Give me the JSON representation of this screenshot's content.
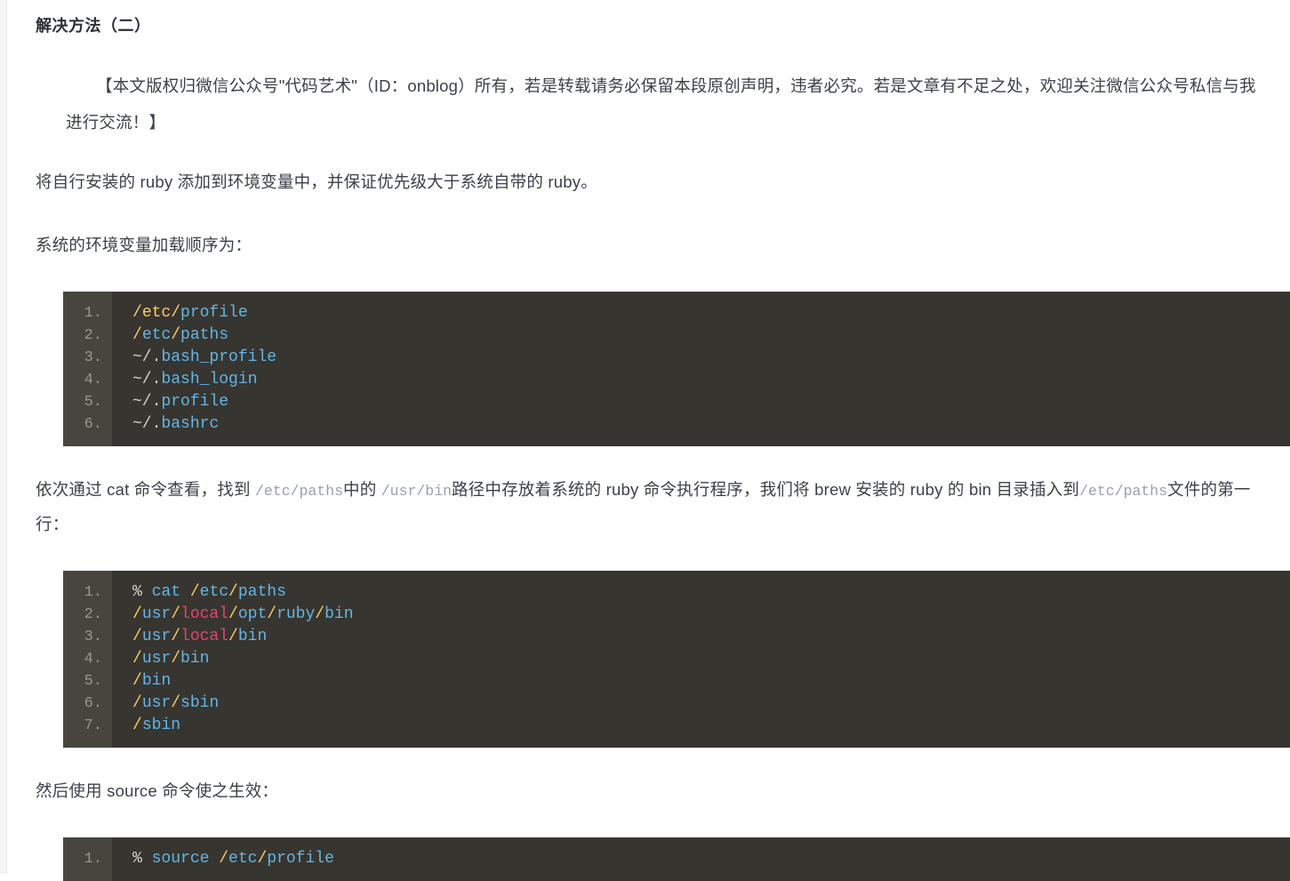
{
  "section": {
    "title": "解决方法（二）"
  },
  "copyright_note": "【本文版权归微信公众号\"代码艺术\"（ID：onblog）所有，若是转载请务必保留本段原创声明，违者必究。若是文章有不足之处，欢迎关注微信公众号私信与我进行交流！】",
  "paragraphs": {
    "p1": "将自行安装的 ruby 添加到环境变量中，并保证优先级大于系统自带的 ruby。",
    "p2": "系统的环境变量加载顺序为：",
    "p3_part1": "依次通过 cat 命令查看，找到 ",
    "p3_code1": "/etc/paths",
    "p3_part2": "中的 ",
    "p3_code2": "/usr/bin",
    "p3_part3": "路径中存放着系统的 ruby 命令执行程序，我们将 brew 安装的 ruby 的 bin 目录插入到",
    "p3_code3": "/etc/paths",
    "p3_part4": "文件的第一行：",
    "p4": "然后使用 source 命令使之生效："
  },
  "code_blocks": [
    {
      "name": "env-load-order",
      "lines": [
        {
          "num": "1.",
          "tokens": [
            {
              "t": "/",
              "c": "t-path"
            },
            {
              "t": "etc",
              "c": "t-path"
            },
            {
              "t": "/",
              "c": "t-path"
            },
            {
              "t": "profile",
              "c": "t-ident"
            }
          ]
        },
        {
          "num": "2.",
          "tokens": [
            {
              "t": "/",
              "c": "t-path"
            },
            {
              "t": "etc",
              "c": "t-ident"
            },
            {
              "t": "/",
              "c": "t-path"
            },
            {
              "t": "paths",
              "c": "t-ident"
            }
          ]
        },
        {
          "num": "3.",
          "tokens": [
            {
              "t": "~/",
              "c": "t-plain"
            },
            {
              "t": ".",
              "c": "t-plain"
            },
            {
              "t": "bash_profile",
              "c": "t-ident"
            }
          ]
        },
        {
          "num": "4.",
          "tokens": [
            {
              "t": "~/",
              "c": "t-plain"
            },
            {
              "t": ".",
              "c": "t-plain"
            },
            {
              "t": "bash_login",
              "c": "t-ident"
            }
          ]
        },
        {
          "num": "5.",
          "tokens": [
            {
              "t": "~/",
              "c": "t-plain"
            },
            {
              "t": ".",
              "c": "t-plain"
            },
            {
              "t": "profile",
              "c": "t-ident"
            }
          ]
        },
        {
          "num": "6.",
          "tokens": [
            {
              "t": "~/",
              "c": "t-plain"
            },
            {
              "t": ".",
              "c": "t-plain"
            },
            {
              "t": "bashrc",
              "c": "t-ident"
            }
          ]
        }
      ]
    },
    {
      "name": "cat-etc-paths",
      "lines": [
        {
          "num": "1.",
          "tokens": [
            {
              "t": "% ",
              "c": "t-plain"
            },
            {
              "t": "cat",
              "c": "t-cmd"
            },
            {
              "t": " ",
              "c": "t-plain"
            },
            {
              "t": "/",
              "c": "t-path"
            },
            {
              "t": "etc",
              "c": "t-ident"
            },
            {
              "t": "/",
              "c": "t-path"
            },
            {
              "t": "paths",
              "c": "t-ident"
            }
          ]
        },
        {
          "num": "2.",
          "tokens": [
            {
              "t": "/",
              "c": "t-path"
            },
            {
              "t": "usr",
              "c": "t-ident"
            },
            {
              "t": "/",
              "c": "t-path"
            },
            {
              "t": "local",
              "c": "t-kw"
            },
            {
              "t": "/",
              "c": "t-path"
            },
            {
              "t": "opt",
              "c": "t-ident"
            },
            {
              "t": "/",
              "c": "t-path"
            },
            {
              "t": "ruby",
              "c": "t-ident"
            },
            {
              "t": "/",
              "c": "t-path"
            },
            {
              "t": "bin",
              "c": "t-ident"
            }
          ]
        },
        {
          "num": "3.",
          "tokens": [
            {
              "t": "/",
              "c": "t-path"
            },
            {
              "t": "usr",
              "c": "t-ident"
            },
            {
              "t": "/",
              "c": "t-path"
            },
            {
              "t": "local",
              "c": "t-kw"
            },
            {
              "t": "/",
              "c": "t-path"
            },
            {
              "t": "bin",
              "c": "t-ident"
            }
          ]
        },
        {
          "num": "4.",
          "tokens": [
            {
              "t": "/",
              "c": "t-path"
            },
            {
              "t": "usr",
              "c": "t-ident"
            },
            {
              "t": "/",
              "c": "t-path"
            },
            {
              "t": "bin",
              "c": "t-ident"
            }
          ]
        },
        {
          "num": "5.",
          "tokens": [
            {
              "t": "/",
              "c": "t-path"
            },
            {
              "t": "bin",
              "c": "t-ident"
            }
          ]
        },
        {
          "num": "6.",
          "tokens": [
            {
              "t": "/",
              "c": "t-path"
            },
            {
              "t": "usr",
              "c": "t-ident"
            },
            {
              "t": "/",
              "c": "t-path"
            },
            {
              "t": "sbin",
              "c": "t-ident"
            }
          ]
        },
        {
          "num": "7.",
          "tokens": [
            {
              "t": "/",
              "c": "t-path"
            },
            {
              "t": "sbin",
              "c": "t-ident"
            }
          ]
        }
      ]
    },
    {
      "name": "source-etc-profile",
      "lines": [
        {
          "num": "1.",
          "tokens": [
            {
              "t": "% ",
              "c": "t-plain"
            },
            {
              "t": "source",
              "c": "t-cmd"
            },
            {
              "t": " ",
              "c": "t-plain"
            },
            {
              "t": "/",
              "c": "t-path"
            },
            {
              "t": "etc",
              "c": "t-ident"
            },
            {
              "t": "/",
              "c": "t-path"
            },
            {
              "t": "profile",
              "c": "t-ident"
            }
          ]
        }
      ]
    }
  ],
  "colors": {
    "code_bg": "#37352f",
    "gutter_bg": "#48453f",
    "path_yellow": "#ffcc66",
    "ident_blue": "#62b6e8",
    "keyword_red": "#e8436f",
    "text": "#3c4049",
    "page_bg": "#ffffff"
  }
}
